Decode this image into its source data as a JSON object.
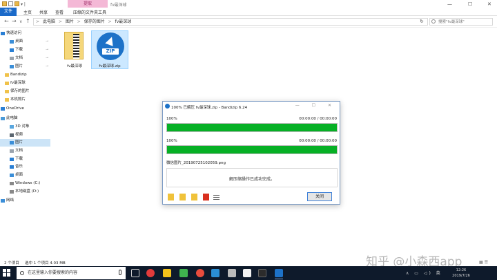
{
  "window": {
    "quick_access_more": "▾ |",
    "context_tab": "提取",
    "title": "fv最深球",
    "controls": {
      "minimize": "—",
      "maximize": "☐",
      "close": "✕"
    }
  },
  "ribbon": {
    "tabs": [
      "文件",
      "主页",
      "共享",
      "查看",
      "压缩的文件夹工具"
    ]
  },
  "nav": {
    "back": "←",
    "forward": "→",
    "up_dropdown": "∨",
    "up": "↑"
  },
  "address": {
    "segments": [
      "此电脑",
      "图片",
      "保存的图片",
      "fv最深球"
    ],
    "separator": ">"
  },
  "search": {
    "placeholder": "搜索\"fv最深球\""
  },
  "refresh": "↻",
  "sidebar": {
    "items": [
      {
        "label": "快速访问",
        "icon": "star-icon",
        "pinned": false,
        "selected": false
      },
      {
        "label": "桌面",
        "icon": "desktop-icon",
        "pinned": true,
        "selected": false
      },
      {
        "label": "下载",
        "icon": "download-icon",
        "pinned": true,
        "selected": false
      },
      {
        "label": "文档",
        "icon": "document-icon",
        "pinned": true,
        "selected": false
      },
      {
        "label": "图片",
        "icon": "picture-icon",
        "pinned": true,
        "selected": false
      },
      {
        "label": "Bandizip",
        "icon": "folder-icon",
        "pinned": false,
        "selected": false
      },
      {
        "label": "fv最深球",
        "icon": "folder-icon",
        "pinned": false,
        "selected": false
      },
      {
        "label": "保存的图片",
        "icon": "folder-icon",
        "pinned": false,
        "selected": false
      },
      {
        "label": "本机照片",
        "icon": "folder-icon",
        "pinned": false,
        "selected": false
      },
      {
        "label": "OneDrive",
        "icon": "cloud-icon",
        "pinned": false,
        "selected": false
      },
      {
        "label": "此电脑",
        "icon": "computer-icon",
        "pinned": false,
        "selected": false
      },
      {
        "label": "3D 对象",
        "icon": "cube-icon",
        "pinned": false,
        "selected": false
      },
      {
        "label": "视频",
        "icon": "video-icon",
        "pinned": false,
        "selected": false
      },
      {
        "label": "图片",
        "icon": "picture-icon",
        "pinned": false,
        "selected": true
      },
      {
        "label": "文档",
        "icon": "document-icon",
        "pinned": false,
        "selected": false
      },
      {
        "label": "下载",
        "icon": "download-icon",
        "pinned": false,
        "selected": false
      },
      {
        "label": "音乐",
        "icon": "music-icon",
        "pinned": false,
        "selected": false
      },
      {
        "label": "桌面",
        "icon": "desktop-icon",
        "pinned": false,
        "selected": false
      },
      {
        "label": "Windows (C:)",
        "icon": "drive-icon",
        "pinned": false,
        "selected": false
      },
      {
        "label": "本地磁盘 (D:)",
        "icon": "drive-icon",
        "pinned": false,
        "selected": false
      },
      {
        "label": "网络",
        "icon": "network-icon",
        "pinned": false,
        "selected": false
      }
    ]
  },
  "files": [
    {
      "name": "fv最深球",
      "type": "folder",
      "selected": false
    },
    {
      "name": "fv最深球.zip",
      "type": "zip",
      "icon_text": "ZIP",
      "selected": true
    }
  ],
  "status": {
    "count": "2 个项目",
    "selection": "选中 1 个项目  4.03 MB"
  },
  "dialog": {
    "title": "100% 已解压 fv最深球.zip - Bandizip 6.24",
    "controls": "—  ☐  ✕",
    "progress": [
      {
        "label": "100%",
        "time": "00:00:00 / 00:00:00",
        "fraction": 1.0
      },
      {
        "label": "100%",
        "time": "00:00:00 / 00:00:00",
        "fraction": 1.0
      }
    ],
    "current_file": "微信图片_20190725102059.png",
    "message": "解压缩操作已成功完成。",
    "close_label": "关闭"
  },
  "watermark": "知乎 @小森西app",
  "taskbar": {
    "search_text": "在这里输入你要搜索的内容",
    "time": "12:26",
    "date": "2019/7/26",
    "tray": "∧  ▭  ◁)  英"
  },
  "colors": {
    "accent": "#1b6ac9",
    "progress": "#06b025",
    "selection": "#cce4f7",
    "context_tab": "#f4b8d6",
    "taskbar": "#0e1a2b"
  }
}
